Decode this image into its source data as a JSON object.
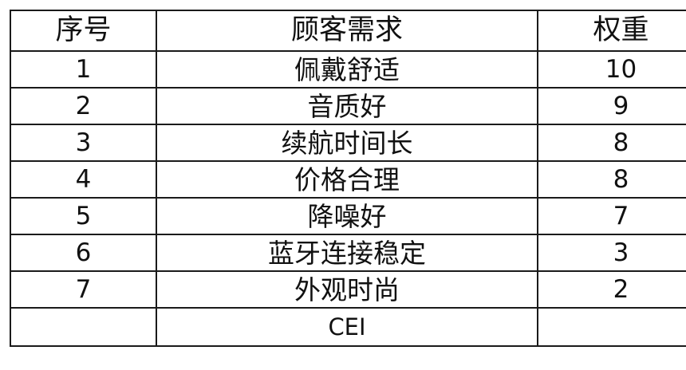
{
  "table": {
    "headers": {
      "index": "序号",
      "requirement": "顾客需求",
      "weight": "权重"
    },
    "rows": [
      {
        "index": "1",
        "requirement": "佩戴舒适",
        "weight": "10"
      },
      {
        "index": "2",
        "requirement": "音质好",
        "weight": "9"
      },
      {
        "index": "3",
        "requirement": "续航时间长",
        "weight": "8"
      },
      {
        "index": "4",
        "requirement": "价格合理",
        "weight": "8"
      },
      {
        "index": "5",
        "requirement": "降噪好",
        "weight": "7"
      },
      {
        "index": "6",
        "requirement": "蓝牙连接稳定",
        "weight": "3"
      },
      {
        "index": "7",
        "requirement": "外观时尚",
        "weight": "2"
      }
    ],
    "footer": {
      "index": "",
      "requirement": "CEI",
      "weight": ""
    }
  }
}
